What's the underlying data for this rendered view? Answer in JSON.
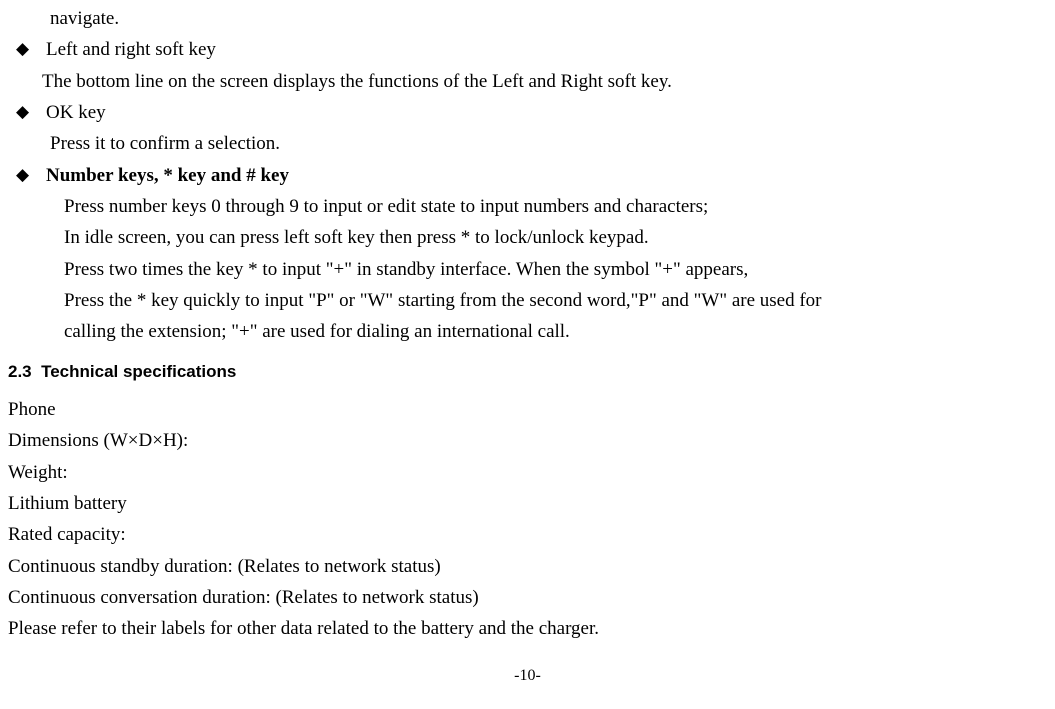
{
  "lines": {
    "navigate": "navigate.",
    "leftRightSoftKey": "Left and right soft key",
    "leftRightDesc": "The bottom line on the screen displays the functions of the Left and Right soft key.",
    "okKey": "OK key",
    "okKeyDesc": "Press it to confirm a selection.",
    "numberKeys": "Number keys, * key and # key",
    "numDesc1": "Press number keys 0 through 9 to input or edit state to input numbers and characters;",
    "numDesc2": "In idle screen, you can press left soft key then press * to lock/unlock keypad.",
    "numDesc3": "Press two times the key * to input \"+\" in standby interface. When the symbol \"+\" appears,",
    "numDesc4": "Press the * key quickly to input \"P\" or \"W\" starting from the second word,\"P\" and \"W\" are used for",
    "numDesc5": "calling the extension; \"+\" are used for dialing an international call."
  },
  "section": {
    "number": "2.3",
    "title": "Technical specifications"
  },
  "specs": {
    "phone": "Phone",
    "dimensions": "Dimensions (W×D×H):",
    "weight": "Weight:",
    "lithium": "Lithium battery",
    "rated": "Rated capacity:",
    "standby": "Continuous standby duration: (Relates to network status)",
    "conversation": "Continuous conversation duration: (Relates to network status)",
    "refer": "Please refer to their labels for other data related to the battery and the charger."
  },
  "pageNumber": "-10-"
}
